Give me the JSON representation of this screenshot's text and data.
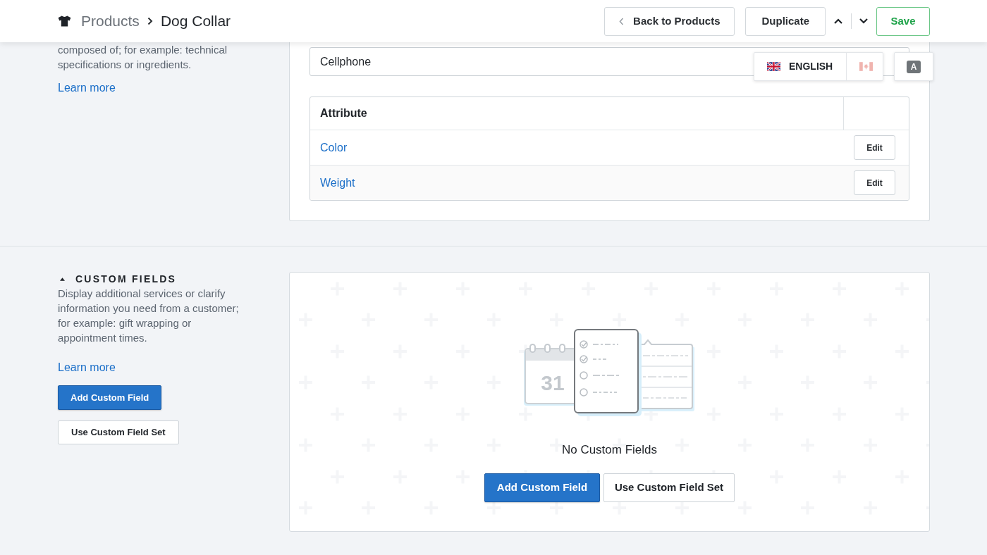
{
  "header": {
    "breadcrumb": [
      {
        "label": "Products",
        "current": false
      },
      {
        "label": "Dog Collar",
        "current": true
      }
    ],
    "actions": [
      {
        "kind": "back",
        "label": "Back to Products"
      },
      {
        "kind": "duplicate",
        "label": "Duplicate"
      },
      {
        "kind": "previous"
      },
      {
        "kind": "next"
      },
      {
        "kind": "save",
        "label": "Save"
      }
    ]
  },
  "specifications": {
    "description": "composed of; for example: technical specifications or ingredients.",
    "learn_more": "Learn more",
    "product_type": {
      "value": "Cellphone"
    },
    "attributes": {
      "columns": [
        "Attribute"
      ],
      "rows": [
        {
          "attribute": "Color",
          "action": "Edit"
        },
        {
          "attribute": "Weight",
          "action": "Edit"
        }
      ]
    }
  },
  "language_switcher": {
    "languages": [
      {
        "kind": "uk",
        "label": "ENGLISH",
        "selected": true
      },
      {
        "kind": "canada",
        "selected": false
      }
    ],
    "translate_button": "A"
  },
  "custom_fields": {
    "title": "CUSTOM FIELDS",
    "expanded": true,
    "description": "Display additional services or clarify information you need from a customer; for example: gift wrapping or appointment times.",
    "learn_more": "Learn more",
    "buttons": [
      {
        "kind": "add",
        "label": "Add Custom Field"
      },
      {
        "kind": "use_set",
        "label": "Use Custom Field Set"
      }
    ],
    "empty_state": {
      "calendar_day": "31",
      "message": "No Custom Fields",
      "buttons": [
        {
          "kind": "add",
          "label": "Add Custom Field"
        },
        {
          "kind": "use_set",
          "label": "Use Custom Field Set"
        }
      ]
    }
  }
}
